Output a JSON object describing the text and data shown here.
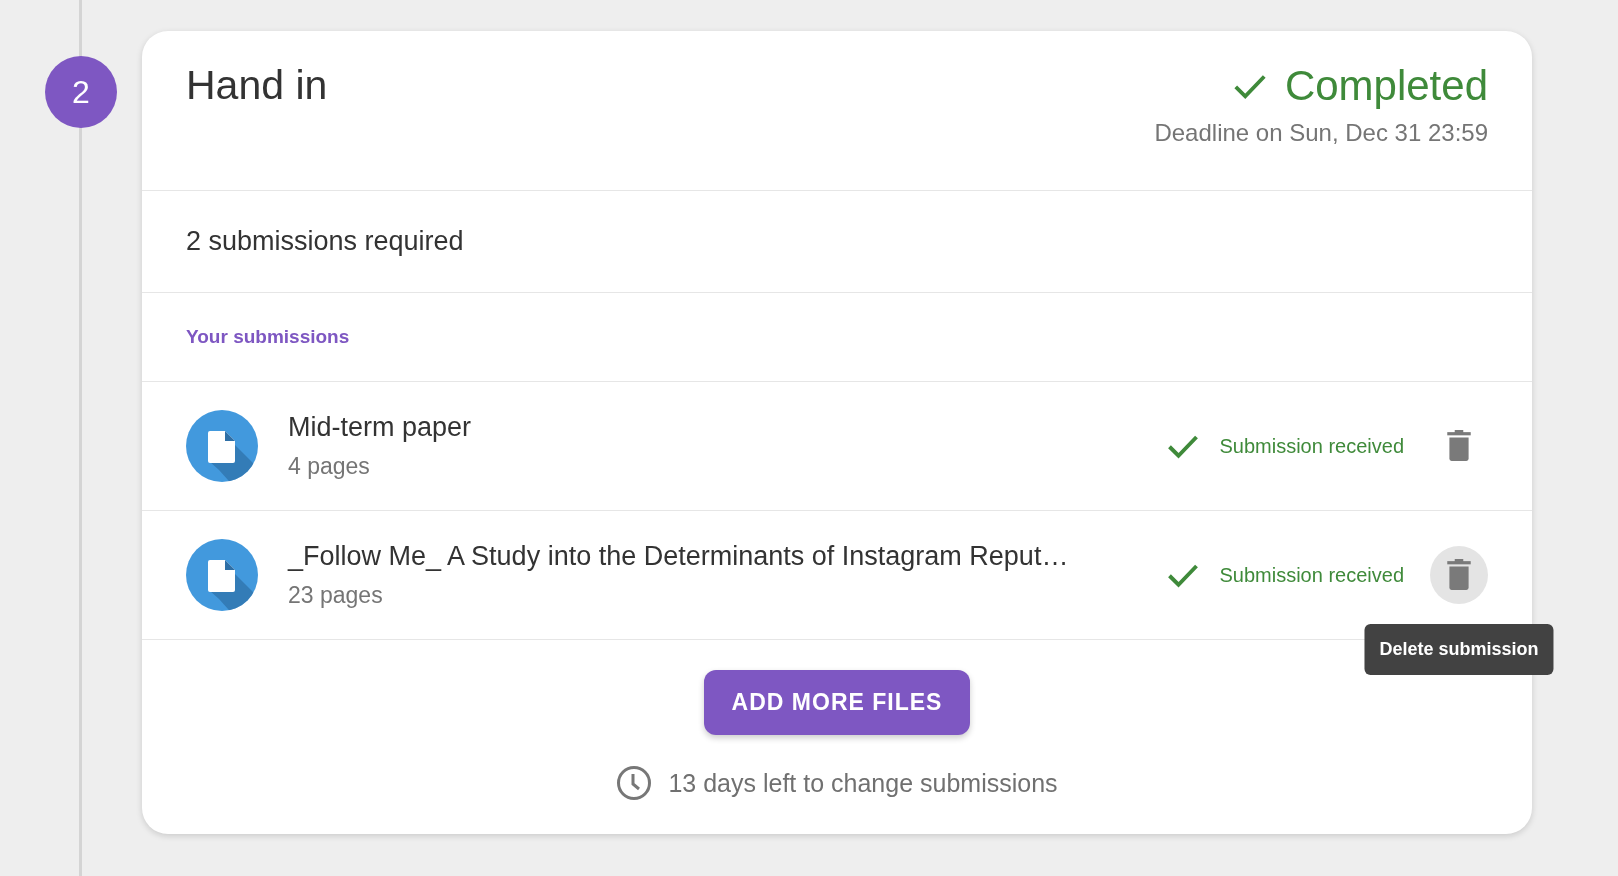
{
  "step": {
    "number": "2"
  },
  "card": {
    "title": "Hand in",
    "status": {
      "label": "Completed",
      "completed": true
    },
    "deadline": "Deadline on Sun, Dec 31 23:59",
    "requirement": "2 submissions required",
    "section_label": "Your submissions",
    "submissions": [
      {
        "name": "Mid-term paper",
        "pages": "4 pages",
        "status": "Submission received",
        "received": true,
        "hovered": false
      },
      {
        "name": "_Follow Me_ A Study into the Determinants of Instagram Reput…",
        "pages": "23 pages",
        "status": "Submission received",
        "received": true,
        "hovered": true,
        "tooltip": "Delete submission"
      }
    ],
    "add_button": "ADD MORE FILES",
    "time_left": "13 days left to change submissions"
  }
}
